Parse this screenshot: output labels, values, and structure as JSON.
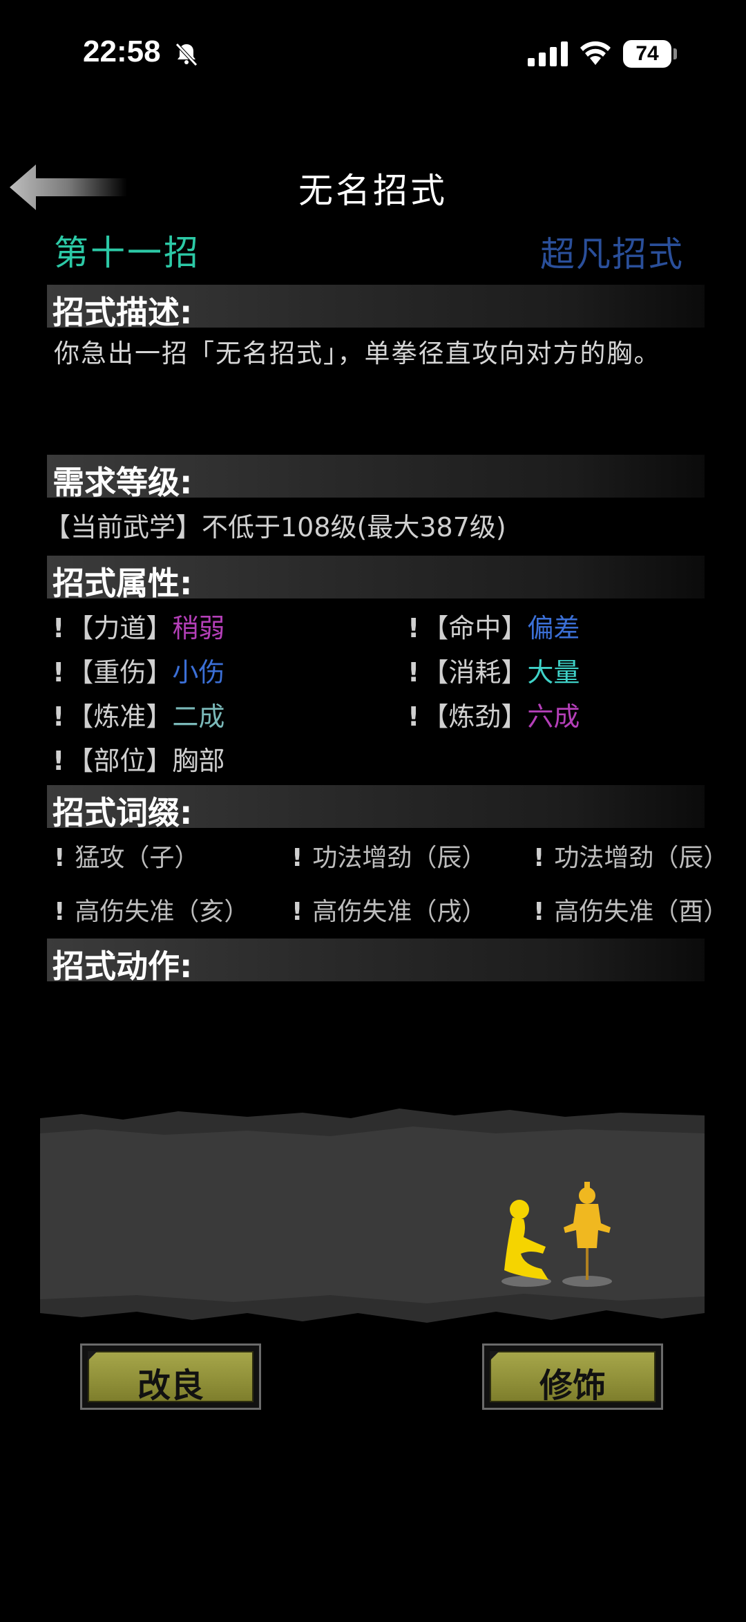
{
  "status_bar": {
    "time": "22:58",
    "battery": "74"
  },
  "header": {
    "title": "无名招式",
    "move_index": "第十一招",
    "move_grade": "超凡招式"
  },
  "sections": {
    "description": "招式描述:",
    "requirement": "需求等级:",
    "attributes": "招式属性:",
    "affixes": "招式词缀:",
    "actions": "招式动作:"
  },
  "description_text": "你急出一招「无名招式」，单拳径直攻向对方的胸。",
  "requirement_text": "【当前武学】不低于108级(最大387级)",
  "attributes": [
    {
      "mark": "!",
      "label": "【力道】",
      "value": "稍弱",
      "color": "#b43fb8"
    },
    {
      "mark": "!",
      "label": "【命中】",
      "value": "偏差",
      "color": "#3b6fd6"
    },
    {
      "mark": "!",
      "label": "【重伤】",
      "value": "小伤",
      "color": "#3b6fd6"
    },
    {
      "mark": "!",
      "label": "【消耗】",
      "value": "大量",
      "color": "#3fd2c8"
    },
    {
      "mark": "!",
      "label": "【炼准】",
      "value": "二成",
      "color": "#7ab8b8"
    },
    {
      "mark": "!",
      "label": "【炼劲】",
      "value": "六成",
      "color": "#b43fb8"
    },
    {
      "mark": "!",
      "label": "【部位】",
      "value": "胸部",
      "color": "#d0d0d0"
    }
  ],
  "affixes": [
    {
      "mark": "!",
      "text": "猛攻（子）"
    },
    {
      "mark": "!",
      "text": "功法增劲（辰）"
    },
    {
      "mark": "!",
      "text": "功法增劲（辰）"
    },
    {
      "mark": "!",
      "text": "高伤失准（亥）"
    },
    {
      "mark": "!",
      "text": "高伤失准（戌）"
    },
    {
      "mark": "!",
      "text": "高伤失准（酉）"
    }
  ],
  "buttons": {
    "improve": "改良",
    "decorate": "修饰"
  },
  "icons": {
    "back": "back-arrow-icon",
    "bell": "bell-slash-icon",
    "signal": "cellular-signal-icon",
    "wifi": "wifi-icon"
  },
  "colors": {
    "accent_green": "#2cc9a6",
    "grade_blue": "#2a4f9a",
    "button_olive": "#9a9a40",
    "figure_yellow": "#f5d400"
  }
}
